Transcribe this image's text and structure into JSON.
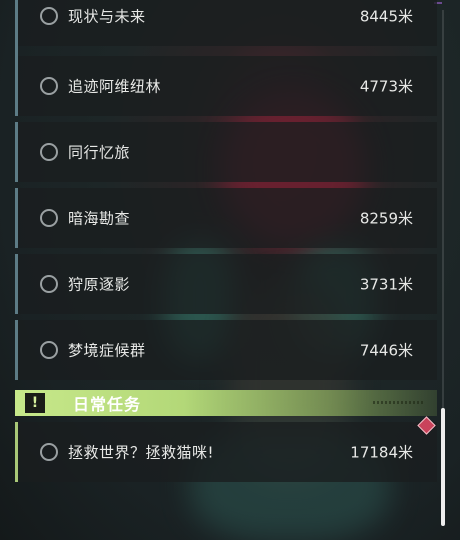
{
  "tasks": [
    {
      "name": "现状与未来",
      "distance": "8445米"
    },
    {
      "name": "追迹阿维纽林",
      "distance": "4773米"
    },
    {
      "name": "同行忆旅",
      "distance": ""
    },
    {
      "name": "暗海勘查",
      "distance": "8259米"
    },
    {
      "name": "狩原逐影",
      "distance": "3731米"
    },
    {
      "name": "梦境症候群",
      "distance": "7446米"
    }
  ],
  "daily_section": {
    "title": "日常任务",
    "badge_icon": "exclamation-icon",
    "items": [
      {
        "name": "拯救世界？拯救猫咪!",
        "distance": "17184米"
      }
    ]
  },
  "colors": {
    "accent_main": "#5d7c86",
    "accent_daily": "#a9c878",
    "section_header": "#c7e88a",
    "alert_marker": "#c9435b"
  }
}
